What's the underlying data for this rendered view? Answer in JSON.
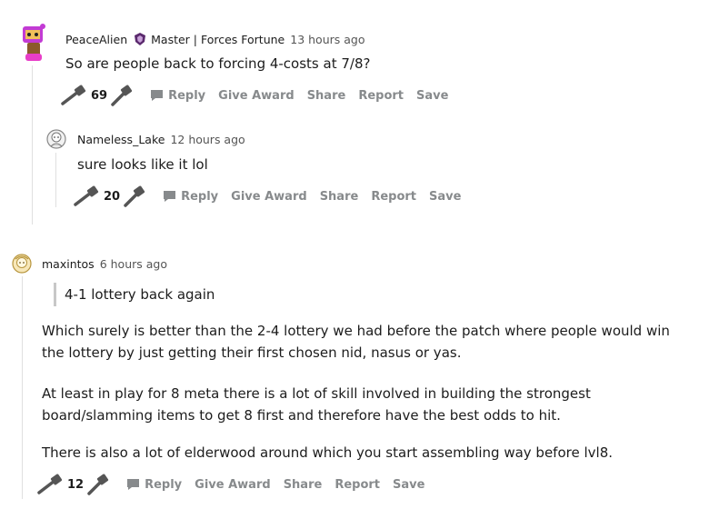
{
  "comments": [
    {
      "author": "PeaceAlien",
      "flair": "Master | Forces Fortune",
      "time": "13 hours ago",
      "body": "So are people back to forcing 4-costs at 7/8?",
      "score": "69"
    },
    {
      "author": "Nameless_Lake",
      "time": "12 hours ago",
      "body": "sure looks like it lol",
      "score": "20"
    },
    {
      "author": "maxintos",
      "time": "6 hours ago",
      "quote": "4-1 lottery back again",
      "paragraphs": [
        "Which surely is better than the 2-4 lottery we had before the patch where people would win",
        "the lottery by just getting their first chosen nid, nasus or yas.",
        "At least in play for 8 meta there is a lot of skill involved in building the strongest",
        "board/slamming items to get 8 first and therefore have the best odds to hit.",
        "There is also a lot of elderwood around which you start assembling way before lvl8."
      ],
      "score": "12"
    }
  ],
  "actions": {
    "reply": "Reply",
    "give_award": "Give Award",
    "share": "Share",
    "report": "Report",
    "save": "Save"
  },
  "icons": {
    "upvote": "hammer-upvote-icon",
    "downvote": "hammer-downvote-icon",
    "reply": "comment-bubble-icon",
    "flair": "crest-icon"
  },
  "colors": {
    "muted": "#878a8c",
    "avatar_purple": "#c23bd4",
    "thread_line": "#e0e0e0"
  }
}
